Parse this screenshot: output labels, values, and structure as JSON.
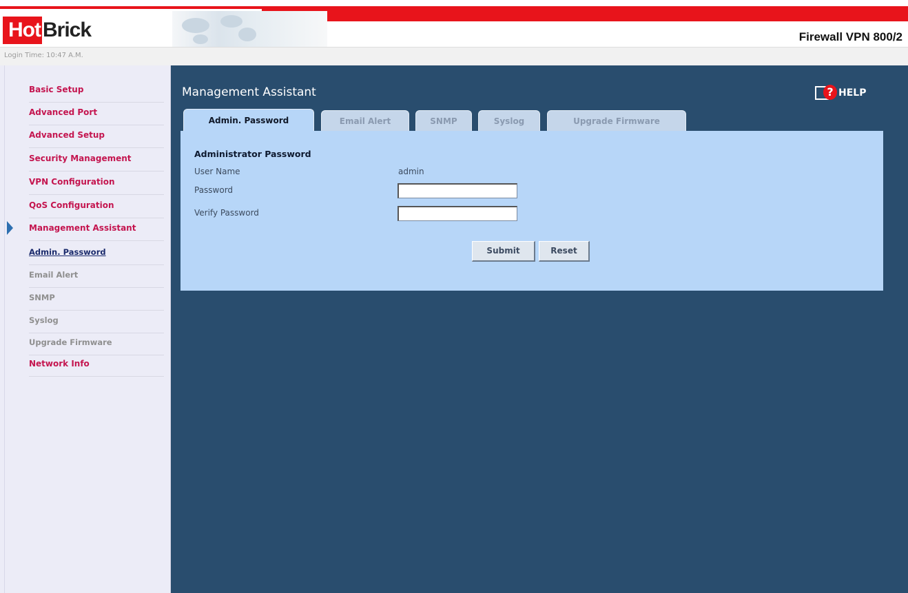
{
  "header": {
    "logo_hot": "Hot",
    "logo_brick": "Brick",
    "login_time": "Login Time: 10:47 A.M.",
    "product_name": "Firewall VPN 800/2"
  },
  "sidebar": {
    "items": [
      {
        "label": "Basic Setup"
      },
      {
        "label": "Advanced Port"
      },
      {
        "label": "Advanced Setup"
      },
      {
        "label": "Security Management"
      },
      {
        "label": "VPN Configuration"
      },
      {
        "label": "QoS Configuration"
      },
      {
        "label": "Management Assistant",
        "active": true
      },
      {
        "label": "Admin. Password",
        "sub": true,
        "active": true
      },
      {
        "label": "Email Alert",
        "sub": true
      },
      {
        "label": "SNMP",
        "sub": true
      },
      {
        "label": "Syslog",
        "sub": true
      },
      {
        "label": "Upgrade Firmware",
        "sub": true
      },
      {
        "label": "Network Info"
      }
    ]
  },
  "main": {
    "title": "Management Assistant",
    "help_label": "HELP",
    "tabs": [
      {
        "label": "Admin. Password",
        "active": true
      },
      {
        "label": "Email Alert"
      },
      {
        "label": "SNMP"
      },
      {
        "label": "Syslog"
      },
      {
        "label": "Upgrade Firmware"
      }
    ],
    "form": {
      "section_title": "Administrator Password",
      "username_label": "User Name",
      "username_value": "admin",
      "password_label": "Password",
      "password_value": "",
      "verify_label": "Verify Password",
      "verify_value": "",
      "submit_label": "Submit",
      "reset_label": "Reset"
    }
  },
  "colors": {
    "brand_red": "#e8141b",
    "main_bg": "#294d6e",
    "panel_bg": "#b7d6f8",
    "nav_text": "#c4154f"
  }
}
